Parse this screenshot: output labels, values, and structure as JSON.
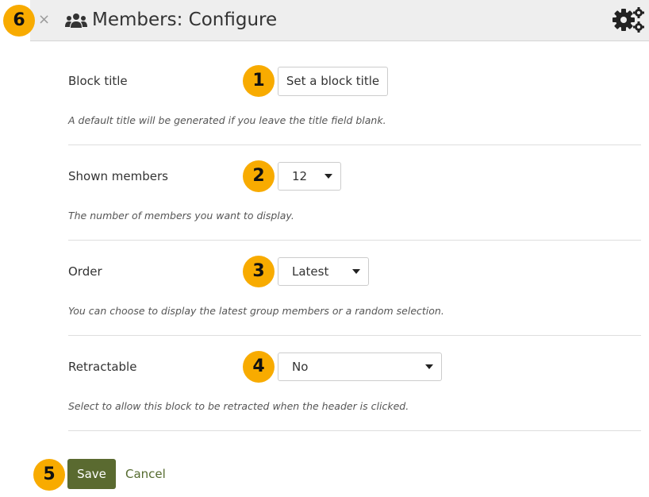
{
  "header": {
    "title": "Members: Configure",
    "close_icon": "×",
    "icons": [
      "users-icon",
      "cogs-icon",
      "close-icon"
    ]
  },
  "callouts": [
    "1",
    "2",
    "3",
    "4",
    "5",
    "6"
  ],
  "fields": [
    {
      "label": "Block title",
      "type": "button",
      "value": "Set a block title",
      "description": "A default title will be generated if you leave the title field blank."
    },
    {
      "label": "Shown members",
      "type": "select",
      "value": "12",
      "description": "The number of members you want to display."
    },
    {
      "label": "Order",
      "type": "select",
      "value": "Latest",
      "description": "You can choose to display the latest group members or a random selection."
    },
    {
      "label": "Retractable",
      "type": "select",
      "value": "No",
      "description": "Select to allow this block to be retracted when the header is clicked."
    }
  ],
  "actions": {
    "save_label": "Save",
    "cancel_label": "Cancel"
  },
  "colors": {
    "badge": "#f8ab00",
    "save_button": "#5a6a30",
    "cancel_link": "#556b2f",
    "header_bg": "#eeeeee"
  }
}
